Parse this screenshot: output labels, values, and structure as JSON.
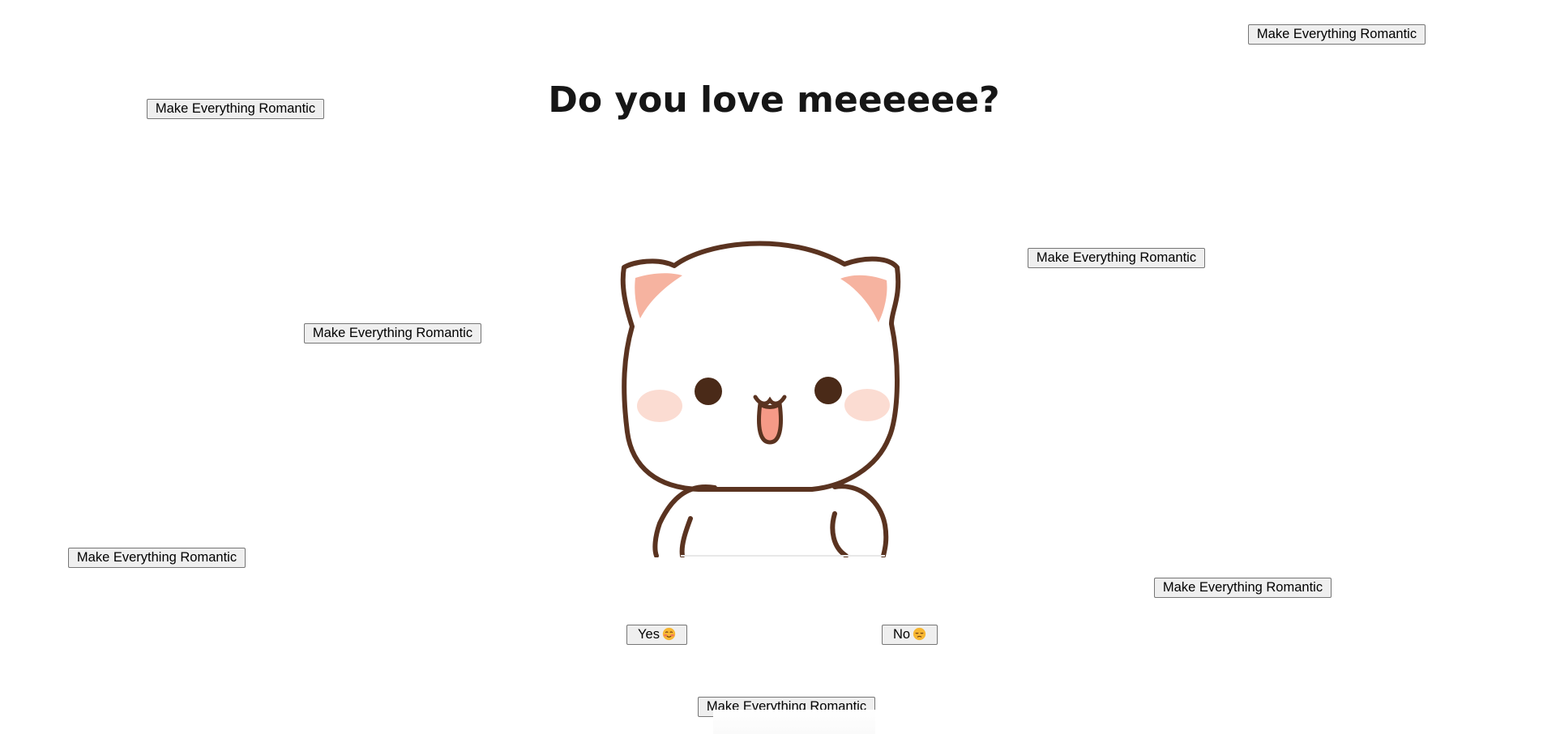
{
  "page": {
    "title": "Do you love meeeeee?"
  },
  "romantic_buttons": [
    {
      "label": "Make Everything Romantic"
    },
    {
      "label": "Make Everything Romantic"
    },
    {
      "label": "Make Everything Romantic"
    },
    {
      "label": "Make Everything Romantic"
    },
    {
      "label": "Make Everything Romantic"
    },
    {
      "label": "Make Everything Romantic"
    },
    {
      "label": "Make Everything Romantic"
    }
  ],
  "answers": {
    "yes_label": "Yes",
    "yes_icon": "blushing-smile-emoji",
    "no_label": "No",
    "no_icon": "sad-pensive-emoji"
  },
  "illustration": {
    "subject": "cute-white-cat",
    "colors": {
      "outline": "#5a3320",
      "ear_inner": "#f6b3a0",
      "cheek": "#fbdcd2",
      "tongue": "#f59a87",
      "eyes": "#4a2a18"
    }
  }
}
